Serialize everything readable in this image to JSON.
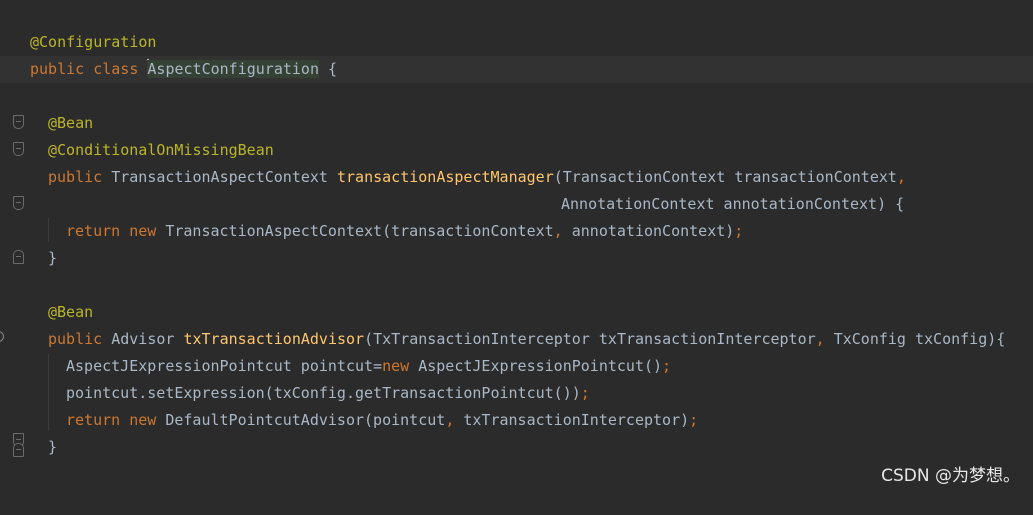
{
  "editor": {
    "lines": [
      "",
      "@Configuration",
      "public class AspectConfiguration {",
      "",
      "@Bean",
      "@ConditionalOnMissingBean",
      "public TransactionAspectContext transactionAspectManager(TransactionContext transactionContext,",
      "AnnotationContext annotationContext) {",
      "return new TransactionAspectContext(transactionContext, annotationContext);",
      "}",
      "",
      "@Bean",
      "public Advisor txTransactionAdvisor(TxTransactionInterceptor txTransactionInterceptor, TxConfig txConfig){",
      "AspectJExpressionPointcut pointcut=new AspectJExpressionPointcut();",
      "pointcut.setExpression(txConfig.getTransactionPointcut());",
      "return new DefaultPointcutAdvisor(pointcut, txTransactionInterceptor);",
      "}"
    ],
    "tokens": {
      "at_configuration": "@Configuration",
      "public": "public",
      "class": "class",
      "class_name": "AspectConfiguration",
      "open_brace": " {",
      "at_bean": "@Bean",
      "at_conditional": "@ConditionalOnMissingBean",
      "return": "return",
      "new": "new",
      "close_brace": "}",
      "tac_type": "TransactionAspectContext",
      "tam_name": "transactionAspectManager",
      "tam_params1": "(TransactionContext transactionContext",
      "comma": ",",
      "tam_params2": "AnnotationContext annotationContext) {",
      "return_tac": "TransactionAspectContext(transactionContext",
      "return_tac_args": " annotationContext)",
      "semi": ";",
      "advisor_type": "Advisor",
      "advisor_name": "txTransactionAdvisor",
      "advisor_params1": "(TxTransactionInterceptor txTransactionInterceptor",
      "advisor_params2": " TxConfig txConfig){",
      "pointcut_decl": "AspectJExpressionPointcut pointcut=",
      "pointcut_ctor": " AspectJExpressionPointcut()",
      "set_expression": "pointcut.setExpression(txConfig.getTransactionPointcut())",
      "dpa_ctor": "DefaultPointcutAdvisor(pointcut",
      "dpa_args": " txTransactionInterceptor)"
    }
  },
  "watermark": "CSDN @为梦想。",
  "colors": {
    "background": "#2b2b2b",
    "keyword": "#cc7832",
    "annotation": "#bbb529",
    "method": "#ffc66d",
    "text": "#a9b7c6",
    "current_line": "#323232",
    "identifier_highlight": "#344134"
  }
}
